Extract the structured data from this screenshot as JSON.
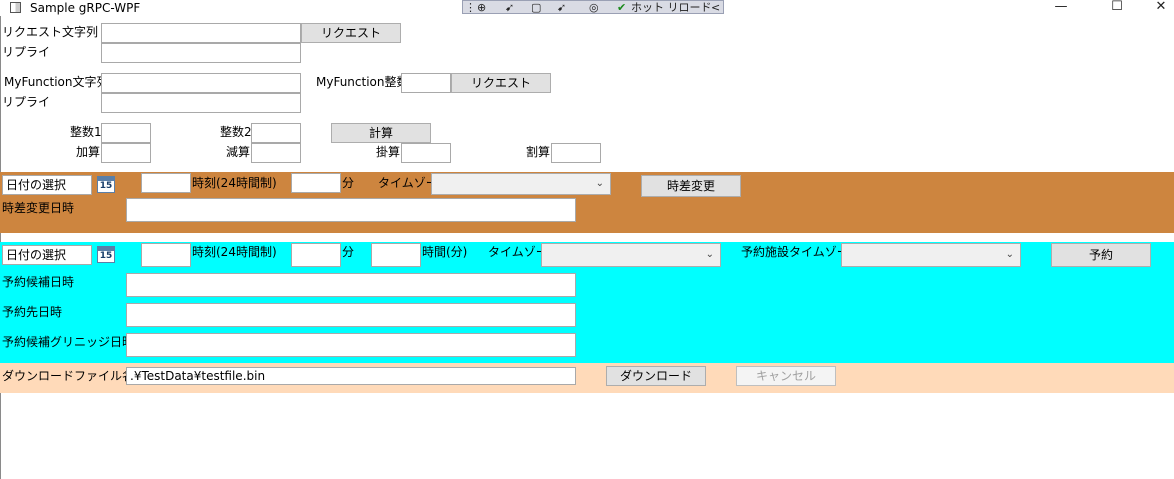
{
  "window": {
    "title": "Sample gRPC-WPF",
    "toolbar_hot_reload": "ホット リロード",
    "toolbar_chevron": "<",
    "minimize": "—",
    "maximize": "☐",
    "close": "✕"
  },
  "section1": {
    "request_label": "リクエスト文字列",
    "request_value": "",
    "request_button": "リクエスト",
    "reply_label": "リプライ",
    "reply_value": ""
  },
  "section2": {
    "myfunction_string_label": "MyFunction文字列",
    "myfunction_string_value": "",
    "myfunction_int_label": "MyFunction整数",
    "myfunction_int_value": "",
    "request_button": "リクエスト",
    "reply_label": "リプライ",
    "reply_value": ""
  },
  "section3": {
    "int1_label": "整数1",
    "int2_label": "整数2",
    "calc_button": "計算",
    "add_label": "加算",
    "sub_label": "減算",
    "mul_label": "掛算",
    "div_label": "割算"
  },
  "timezone_band": {
    "color": "#cd853f",
    "date_placeholder": "日付の選択",
    "calendar_day": "15",
    "time_label": "時刻(24時間制)",
    "minute_label": "分",
    "timezone_label": "タイムゾーン",
    "timezone_value": "",
    "change_button": "時差変更",
    "result_label": "時差変更日時",
    "result_value": ""
  },
  "reserve_band": {
    "color": "#00ffff",
    "date_placeholder": "日付の選択",
    "calendar_day": "15",
    "time_label": "時刻(24時間制)",
    "minute_label": "分",
    "hours_label": "時間(分)",
    "timezone_label": "タイムゾーン",
    "facility_timezone_label": "予約施設タイムゾーン",
    "reserve_button": "予約",
    "candidate_label": "予約候補日時",
    "target_label": "予約先日時",
    "candidate_gmt_label": "予約候補グリニッジ日時"
  },
  "download_band": {
    "color": "#ffdab9",
    "filename_label": "ダウンロードファイル名",
    "filename_value": ".¥TestData¥testfile.bin",
    "download_button": "ダウンロード",
    "cancel_button": "キャンセル"
  }
}
